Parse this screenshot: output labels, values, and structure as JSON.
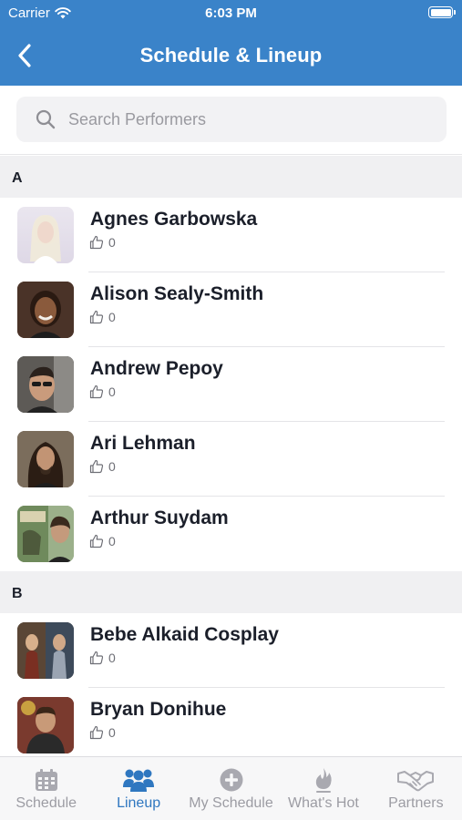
{
  "status_bar": {
    "carrier": "Carrier",
    "time": "6:03 PM"
  },
  "header": {
    "title": "Schedule & Lineup"
  },
  "search": {
    "placeholder": "Search Performers",
    "value": ""
  },
  "sections": [
    {
      "letter": "A",
      "performers": [
        {
          "name": "Agnes Garbowska",
          "likes": "0"
        },
        {
          "name": "Alison Sealy-Smith",
          "likes": "0"
        },
        {
          "name": "Andrew Pepoy",
          "likes": "0"
        },
        {
          "name": "Ari Lehman",
          "likes": "0"
        },
        {
          "name": "Arthur Suydam",
          "likes": "0"
        }
      ]
    },
    {
      "letter": "B",
      "performers": [
        {
          "name": "Bebe Alkaid Cosplay",
          "likes": "0"
        },
        {
          "name": "Bryan Donihue",
          "likes": "0"
        }
      ]
    }
  ],
  "tabs": [
    {
      "label": "Schedule",
      "icon": "calendar-icon"
    },
    {
      "label": "Lineup",
      "icon": "people-icon",
      "active": true
    },
    {
      "label": "My Schedule",
      "icon": "plus-circle-icon"
    },
    {
      "label": "What's Hot",
      "icon": "flame-icon"
    },
    {
      "label": "Partners",
      "icon": "handshake-icon"
    }
  ],
  "colors": {
    "header": "#3a83c9",
    "active_tab": "#2f77c0",
    "inactive_tab": "#9c9ca3"
  }
}
